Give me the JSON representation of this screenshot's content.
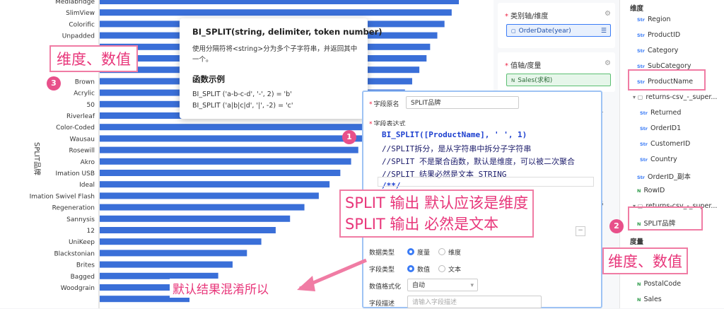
{
  "chart_data": {
    "type": "bar",
    "orientation": "horizontal",
    "ylabel": "SPLIT品牌",
    "categories": [
      "Mediabridge",
      "SlimView",
      "Colorific",
      "Unpadded",
      "",
      "",
      "Accohide",
      "Brown",
      "Acrylic",
      "50",
      "Riverleaf",
      "Color-Coded",
      "Wausau",
      "Rosewill",
      "Akro",
      "Imation USB",
      "Ideal",
      "Imation Swivel Flash",
      "Regeneration",
      "Sannysis",
      "12",
      "UniKeep",
      "Blackstonian",
      "Brites",
      "Bagged",
      "Woodgrain",
      ""
    ],
    "values": [
      100,
      98,
      96,
      94,
      92,
      91,
      89,
      87,
      85,
      83,
      80,
      78,
      75,
      72,
      70,
      67,
      64,
      61,
      57,
      53,
      49,
      45,
      41,
      37,
      33,
      29,
      25
    ],
    "series_color": "#3a6fd8"
  },
  "tooltip": {
    "signature": "BI_SPLIT(string, delimiter, token number)",
    "description": "使用分隔符将<string>分为多个子字符串，并返回其中一个。",
    "examples_heading": "函数示例",
    "example_1": "BI_SPLIT ('a-b-c-d', '-', 2) = 'b'",
    "example_2": "BI_SPLIT ('a|b|c|d', '|', -2) = 'c'"
  },
  "config": {
    "category_axis_title": "类别轴/维度",
    "category_pill": "OrderDate(year)",
    "value_axis_title": "值轴/度量",
    "value_pill": "Sales(求和)",
    "side_number_1": "1",
    "side_number_2": "5"
  },
  "fields": {
    "dimension_header": "维度",
    "measure_header": "度量",
    "items": [
      {
        "tag": "Str",
        "label": "Region"
      },
      {
        "tag": "Str",
        "label": "ProductID"
      },
      {
        "tag": "Str",
        "label": "Category"
      },
      {
        "tag": "Str",
        "label": "SubCategory"
      },
      {
        "tag": "Str",
        "label": "ProductName"
      },
      {
        "tag": "folder",
        "label": "returns-csv_-_super..."
      },
      {
        "tag": "Str",
        "label": "Returned"
      },
      {
        "tag": "Str",
        "label": "OrderID1"
      },
      {
        "tag": "Str",
        "label": "CustomerID"
      },
      {
        "tag": "Str",
        "label": "Country"
      },
      {
        "tag": "Str",
        "label": "OrderID_副本"
      },
      {
        "tag": "N",
        "label": "RowID"
      },
      {
        "tag": "folder",
        "label": "returns-csv_-_super..."
      },
      {
        "tag": "N",
        "label": "SPLIT品牌"
      }
    ],
    "measures": [
      {
        "tag": "N",
        "label": "PostalCode"
      },
      {
        "tag": "N",
        "label": "Sales"
      }
    ]
  },
  "dialog": {
    "field_name_label": "字段原名",
    "field_name_value": "SPLIT品牌",
    "expr_label": "字段表达式",
    "code_line_1_fn": "BI_SPLIT(",
    "code_line_1_arg": "[ProductName], ' ', 1)",
    "code_line_2": "//SPLIT拆分，是从字符串中拆分子字符串",
    "code_line_3": "//SPLIT 不是聚合函数，默认是维度，可以被二次聚合",
    "code_line_4": "//SPLIT 结果必然是文本 STRING",
    "code_line_5": "/**/",
    "data_type_label": "数据类型",
    "data_type_opt1": "度量",
    "data_type_opt2": "维度",
    "field_type_label": "字段类型",
    "field_type_opt1": "数值",
    "field_type_opt2": "文本",
    "format_label": "数值格式化",
    "format_value": "自动",
    "desc_label": "字段描述",
    "desc_placeholder": "请输入字段描述"
  },
  "annotations": {
    "note_top_left": "维度、数值",
    "note_split": "SPLIT 输出 默认应该是维度\nSPLIT 输出 必然是文本",
    "note_split_line1": "SPLIT 输出 默认应该是维度",
    "note_split_line2": "SPLIT 输出 必然是文本",
    "note_bottom_right": "维度、数值",
    "note_bottom": "默认结果混淆所以",
    "badge_1": "1",
    "badge_2": "2",
    "badge_3": "3",
    "accent_color": "#e8367a"
  }
}
